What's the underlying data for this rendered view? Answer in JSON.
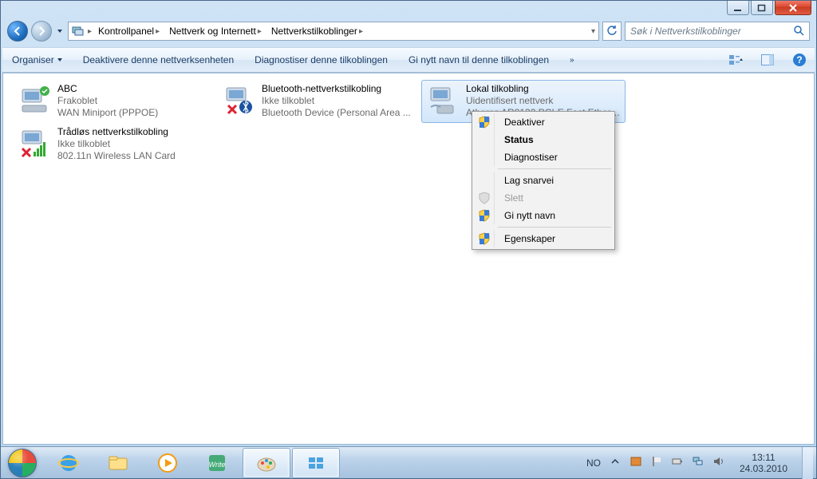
{
  "titlebar": {},
  "breadcrumb": {
    "item1": "Kontrollpanel",
    "item2": "Nettverk og Internett",
    "item3": "Nettverkstilkoblinger"
  },
  "search": {
    "placeholder": "Søk i Nettverkstilkoblinger"
  },
  "toolbar": {
    "organize": "Organiser",
    "disable": "Deaktivere denne nettverksenheten",
    "diagnose": "Diagnostiser denne tilkoblingen",
    "rename": "Gi nytt navn til denne tilkoblingen",
    "overflow": "»"
  },
  "connections": [
    {
      "name": "ABC",
      "status": "Frakoblet",
      "detail": "WAN Miniport (PPPOE)",
      "icon": "dialup-ok"
    },
    {
      "name": "Bluetooth-nettverkstilkobling",
      "status": "Ikke tilkoblet",
      "detail": "Bluetooth Device (Personal Area ...",
      "icon": "bt-x"
    },
    {
      "name": "Lokal tilkobling",
      "status": "Uidentifisert nettverk",
      "detail": "Atheros AR8132 PCI-E Fast Ethern...",
      "icon": "lan",
      "selected": true
    },
    {
      "name": "Trådløs nettverkstilkobling",
      "status": "Ikke tilkoblet",
      "detail": "802.11n Wireless LAN Card",
      "icon": "wifi-x"
    }
  ],
  "contextmenu": {
    "items": [
      {
        "label": "Deaktiver",
        "shield": true
      },
      {
        "label": "Status",
        "bold": true
      },
      {
        "label": "Diagnostiser"
      },
      {
        "sep": true
      },
      {
        "label": "Lag snarvei"
      },
      {
        "label": "Slett",
        "shield": true,
        "disabled": true
      },
      {
        "label": "Gi nytt navn",
        "shield": true
      },
      {
        "sep": true
      },
      {
        "label": "Egenskaper",
        "shield": true
      }
    ]
  },
  "tray": {
    "lang": "NO",
    "time": "13:11",
    "date": "24.03.2010"
  }
}
